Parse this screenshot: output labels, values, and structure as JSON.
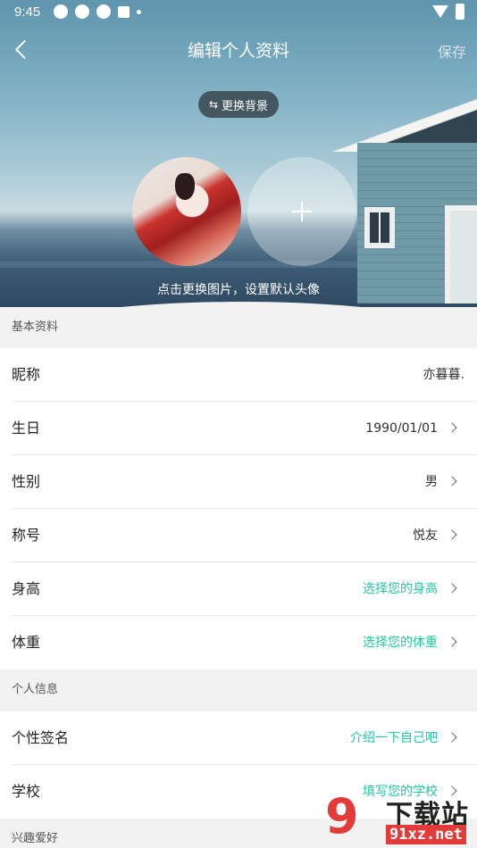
{
  "status_bar": {
    "time": "9:45"
  },
  "header": {
    "title": "编辑个人资料",
    "save_label": "保存",
    "change_bg_label": "更换背景",
    "hint": "点击更换图片，设置默认头像"
  },
  "sections": {
    "basic": "基本资料",
    "personal": "个人信息",
    "interests": "兴趣爱好"
  },
  "basic_rows": [
    {
      "label": "昵称",
      "value": "亦暮暮."
    },
    {
      "label": "生日",
      "value": "1990/01/01"
    },
    {
      "label": "性别",
      "value": "男"
    },
    {
      "label": "称号",
      "value": "悦友"
    },
    {
      "label": "身高",
      "value": "选择您的身高"
    },
    {
      "label": "体重",
      "value": "选择您的体重"
    }
  ],
  "personal_rows": [
    {
      "label": "个性签名",
      "value": "介绍一下自己吧"
    },
    {
      "label": "学校",
      "value": "填写您的学校"
    }
  ],
  "watermark": {
    "logo_text": "9",
    "name": "下载站",
    "url": "91xz.net"
  },
  "colors": {
    "accent": "#21c7a1",
    "section_bg": "#f2f2f2",
    "watermark_red": "#e33a3a"
  },
  "icons": {
    "back": "back-arrow-icon",
    "swap": "swap-icon",
    "add": "plus-icon",
    "chevron": "chevron-right-icon"
  }
}
